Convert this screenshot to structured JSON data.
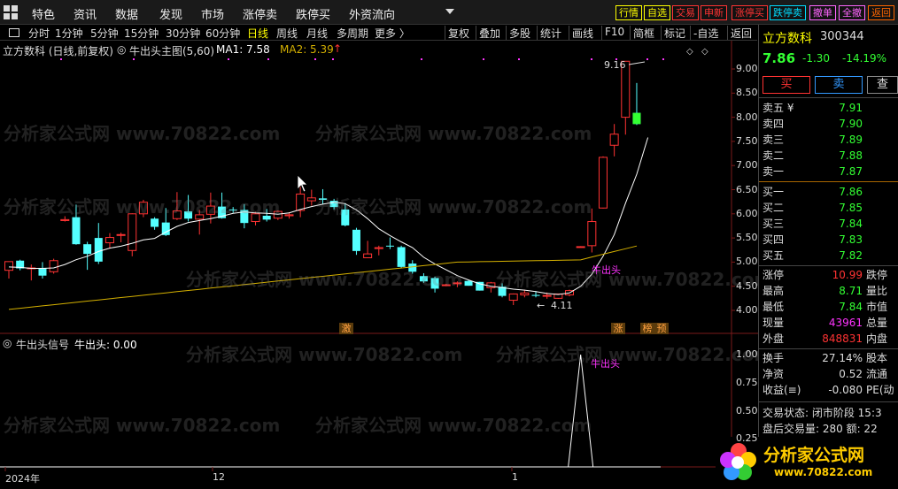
{
  "menu": {
    "items": [
      "特色",
      "资讯",
      "数据",
      "发现",
      "市场",
      "涨停卖",
      "跌停买",
      "外资流向"
    ],
    "quick_buttons": [
      {
        "label": "行情",
        "color": "#ffff00",
        "bg": "#000"
      },
      {
        "label": "自选",
        "color": "#ffff00",
        "bg": "#000"
      },
      {
        "label": "交易",
        "color": "#ff3333",
        "bg": "#000"
      },
      {
        "label": "申新",
        "color": "#ff3333",
        "bg": "#000"
      },
      {
        "label": "涨停买",
        "color": "#ff3333",
        "bg": "#000"
      },
      {
        "label": "跌停卖",
        "color": "#00ddff",
        "bg": "#000"
      },
      {
        "label": "撤单",
        "color": "#ff66ff",
        "bg": "#000"
      },
      {
        "label": "全撤",
        "color": "#ff66ff",
        "bg": "#000"
      },
      {
        "label": "返回",
        "color": "#ff6600",
        "bg": "#000"
      }
    ]
  },
  "toolbar": {
    "timeframes": [
      "分时",
      "1分钟",
      "5分钟",
      "15分钟",
      "30分钟",
      "60分钟",
      "日线",
      "周线",
      "月线",
      "多周期",
      "更多 〉"
    ],
    "active_timeframe": "日线",
    "tools": [
      "复权",
      "叠加",
      "多股",
      "统计",
      "画线",
      "F10",
      "简框",
      "标记",
      "-自选",
      "返回"
    ]
  },
  "main_chart": {
    "stock_title": "立方数科 (日线,前复权)",
    "indicator_name": "牛出头主图(5,60)",
    "ma1_label": "MA1: 7.58",
    "ma2_label": "MA2: 5.39",
    "ma2_arrow": "↑",
    "high_label": "9.16",
    "low_label": "4.11",
    "signal_label": "牛出头",
    "y_ticks": [
      "9.00",
      "8.50",
      "8.00",
      "7.50",
      "7.00",
      "6.50",
      "6.00",
      "5.50",
      "5.00",
      "4.50",
      "4.00"
    ],
    "flags": [
      "激",
      "涨",
      "榜",
      "预"
    ]
  },
  "sub_chart": {
    "title": "牛出头信号",
    "value_label": "牛出头: 0.00",
    "signal_label": "牛出头",
    "y_ticks": [
      "1.00",
      "0.75",
      "0.50",
      "0.25"
    ]
  },
  "x_axis": [
    "2024年",
    "12",
    "1"
  ],
  "watermark": "分析家公式网 www.70822.com",
  "quote": {
    "name": "立方数科",
    "code": "300344",
    "price": "7.86",
    "change": "-1.30",
    "change_pct": "-14.19%",
    "buy_btn": "买",
    "sell_btn": "卖",
    "other_btn": "查",
    "asks": [
      {
        "label": "卖五 ¥",
        "price": "7.91"
      },
      {
        "label": "卖四",
        "price": "7.90"
      },
      {
        "label": "卖三",
        "price": "7.89"
      },
      {
        "label": "卖二",
        "price": "7.88"
      },
      {
        "label": "卖一",
        "price": "7.87"
      }
    ],
    "bids": [
      {
        "label": "买一",
        "price": "7.86"
      },
      {
        "label": "买二",
        "price": "7.85"
      },
      {
        "label": "买三",
        "price": "7.84"
      },
      {
        "label": "买四",
        "price": "7.83"
      },
      {
        "label": "买五",
        "price": "7.82"
      }
    ],
    "stats": [
      {
        "label": "涨停",
        "value": "10.99",
        "color": "#ff3333",
        "label2": "跌停"
      },
      {
        "label": "最高",
        "value": "8.71",
        "color": "#33ff33",
        "label2": "量比"
      },
      {
        "label": "最低",
        "value": "7.84",
        "color": "#33ff33",
        "label2": "市值"
      },
      {
        "label": "现量",
        "value": "43961",
        "color": "#ff33ff",
        "label2": "总量"
      },
      {
        "label": "外盘",
        "value": "848831",
        "color": "#ff3333",
        "label2": "内盘"
      }
    ],
    "stats2": [
      {
        "label": "换手",
        "value": "27.14%",
        "label2": "股本"
      },
      {
        "label": "净资",
        "value": "0.52",
        "label2": "流通"
      },
      {
        "label": "收益(≡)",
        "value": "-0.080",
        "label2": "PE(动"
      }
    ],
    "trade_status": "交易状态: 闭市阶段 15:3",
    "after_hours": "盘后交易量: 280  额: 22"
  },
  "logo": {
    "text": "分析家公式网",
    "url": "www.70822.com"
  },
  "colors": {
    "up": "#ff3333",
    "down": "#54ffff",
    "ma1": "#ffffff",
    "ma2": "#d4b000",
    "signal": "#ff33ff"
  },
  "chart_data": {
    "type": "candlestick",
    "candles": [
      {
        "o": 4.83,
        "h": 4.98,
        "l": 4.66,
        "c": 5.01
      },
      {
        "o": 5.03,
        "h": 5.05,
        "l": 4.83,
        "c": 4.87
      },
      {
        "o": 4.87,
        "h": 4.95,
        "l": 4.62,
        "c": 4.88
      },
      {
        "o": 4.88,
        "h": 5.0,
        "l": 4.66,
        "c": 4.72
      },
      {
        "o": 4.8,
        "h": 5.07,
        "l": 4.76,
        "c": 5.03
      },
      {
        "o": 5.86,
        "h": 5.95,
        "l": 5.84,
        "c": 5.88
      },
      {
        "o": 5.93,
        "h": 6.19,
        "l": 5.36,
        "c": 5.37
      },
      {
        "o": 5.37,
        "h": 5.42,
        "l": 4.84,
        "c": 5.17
      },
      {
        "o": 5.5,
        "h": 5.81,
        "l": 4.96,
        "c": 5.01
      },
      {
        "o": 5.4,
        "h": 5.6,
        "l": 5.28,
        "c": 5.51
      },
      {
        "o": 5.56,
        "h": 5.61,
        "l": 5.41,
        "c": 5.57
      },
      {
        "o": 5.24,
        "h": 6.01,
        "l": 5.12,
        "c": 6.0
      },
      {
        "o": 6.0,
        "h": 6.29,
        "l": 5.93,
        "c": 6.24
      },
      {
        "o": 5.9,
        "h": 5.93,
        "l": 5.67,
        "c": 5.73
      },
      {
        "o": 5.82,
        "h": 6.12,
        "l": 5.54,
        "c": 5.56
      },
      {
        "o": 5.9,
        "h": 6.45,
        "l": 5.87,
        "c": 6.06
      },
      {
        "o": 6.05,
        "h": 6.39,
        "l": 5.84,
        "c": 5.9
      },
      {
        "o": 5.89,
        "h": 6.08,
        "l": 5.57,
        "c": 5.98
      },
      {
        "o": 5.99,
        "h": 6.44,
        "l": 5.8,
        "c": 6.16
      },
      {
        "o": 6.15,
        "h": 6.44,
        "l": 5.9,
        "c": 5.91
      },
      {
        "o": 6.09,
        "h": 6.14,
        "l": 6.02,
        "c": 6.08
      },
      {
        "o": 6.08,
        "h": 6.2,
        "l": 5.7,
        "c": 5.81
      },
      {
        "o": 5.84,
        "h": 6.04,
        "l": 5.76,
        "c": 6.0
      },
      {
        "o": 5.96,
        "h": 6.1,
        "l": 5.84,
        "c": 5.88
      },
      {
        "o": 5.91,
        "h": 6.07,
        "l": 5.87,
        "c": 6.05
      },
      {
        "o": 5.96,
        "h": 6.03,
        "l": 5.9,
        "c": 5.98
      },
      {
        "o": 6.07,
        "h": 6.62,
        "l": 5.93,
        "c": 6.41
      },
      {
        "o": 6.27,
        "h": 6.5,
        "l": 6.17,
        "c": 6.33
      },
      {
        "o": 6.32,
        "h": 6.51,
        "l": 6.2,
        "c": 6.29
      },
      {
        "o": 6.27,
        "h": 6.31,
        "l": 6.09,
        "c": 6.14
      },
      {
        "o": 6.09,
        "h": 6.22,
        "l": 5.74,
        "c": 5.76
      },
      {
        "o": 5.67,
        "h": 5.71,
        "l": 5.15,
        "c": 5.23
      },
      {
        "o": 5.09,
        "h": 5.44,
        "l": 5.09,
        "c": 5.17
      },
      {
        "o": 5.28,
        "h": 5.34,
        "l": 5.14,
        "c": 5.3
      },
      {
        "o": 5.34,
        "h": 5.51,
        "l": 5.27,
        "c": 5.33
      },
      {
        "o": 5.31,
        "h": 5.34,
        "l": 4.87,
        "c": 4.9
      },
      {
        "o": 4.97,
        "h": 5.04,
        "l": 4.76,
        "c": 4.8
      },
      {
        "o": 4.71,
        "h": 4.77,
        "l": 4.57,
        "c": 4.6
      },
      {
        "o": 4.67,
        "h": 4.7,
        "l": 4.37,
        "c": 4.45
      },
      {
        "o": 4.52,
        "h": 4.55,
        "l": 4.5,
        "c": 4.53
      },
      {
        "o": 4.56,
        "h": 4.6,
        "l": 4.48,
        "c": 4.57
      },
      {
        "o": 4.61,
        "h": 4.62,
        "l": 4.51,
        "c": 4.51
      },
      {
        "o": 4.59,
        "h": 4.59,
        "l": 4.41,
        "c": 4.41
      },
      {
        "o": 4.47,
        "h": 4.59,
        "l": 4.37,
        "c": 4.57
      },
      {
        "o": 4.49,
        "h": 4.56,
        "l": 4.27,
        "c": 4.3
      },
      {
        "o": 4.21,
        "h": 4.35,
        "l": 4.11,
        "c": 4.34
      },
      {
        "o": 4.32,
        "h": 4.43,
        "l": 4.27,
        "c": 4.36
      },
      {
        "o": 4.32,
        "h": 4.4,
        "l": 4.27,
        "c": 4.3
      },
      {
        "o": 4.3,
        "h": 4.37,
        "l": 4.24,
        "c": 4.31
      },
      {
        "o": 4.25,
        "h": 4.34,
        "l": 4.24,
        "c": 4.34
      },
      {
        "o": 4.32,
        "h": 4.43,
        "l": 4.29,
        "c": 4.41
      },
      {
        "o": 5.31,
        "h": 5.33,
        "l": 5.31,
        "c": 5.32
      },
      {
        "o": 5.34,
        "h": 6.11,
        "l": 5.2,
        "c": 5.84
      },
      {
        "o": 6.12,
        "h": 7.19,
        "l": 6.11,
        "c": 7.17
      },
      {
        "o": 7.42,
        "h": 7.86,
        "l": 7.19,
        "c": 7.65
      },
      {
        "o": 8.0,
        "h": 9.16,
        "l": 7.64,
        "c": 9.16
      },
      {
        "o": 8.09,
        "h": 8.71,
        "l": 7.84,
        "c": 7.86
      }
    ],
    "ma1": [
      4.9,
      4.89,
      4.87,
      4.87,
      4.88,
      4.95,
      5.05,
      5.12,
      5.22,
      5.29,
      5.33,
      5.39,
      5.46,
      5.49,
      5.62,
      5.74,
      5.82,
      5.86,
      5.9,
      5.95,
      6.01,
      6.04,
      6.02,
      6.01,
      5.99,
      6.02,
      6.09,
      6.15,
      6.2,
      6.24,
      6.21,
      6.08,
      5.9,
      5.69,
      5.55,
      5.42,
      5.3,
      5.1,
      4.96,
      4.84,
      4.72,
      4.63,
      4.55,
      4.5,
      4.47,
      4.44,
      4.42,
      4.39,
      4.35,
      4.33,
      4.36,
      4.5,
      4.75,
      5.12,
      5.57,
      6.22,
      6.82,
      7.58
    ],
    "ma2_range": [
      4.02,
      5.39
    ],
    "ylim": [
      3.8,
      9.3
    ],
    "signal": {
      "index": 51,
      "value": 1.0
    }
  }
}
